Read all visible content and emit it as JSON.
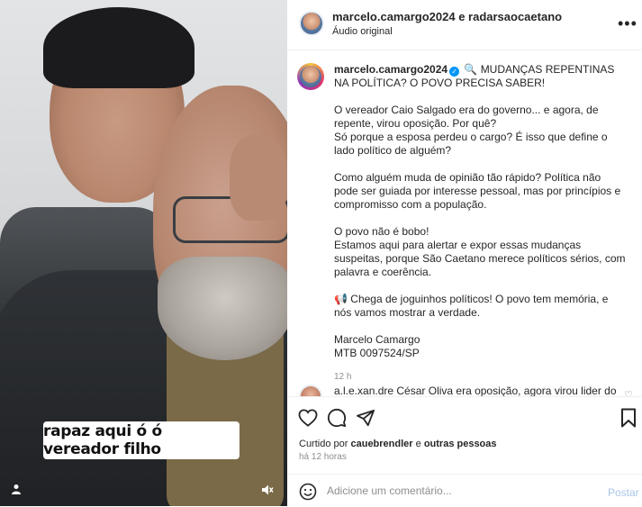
{
  "media": {
    "caption_overlay": "rapaz aqui ó ó vereador filho",
    "user_icon": "user-icon",
    "mute_icon": "speaker-muted-icon"
  },
  "header": {
    "username": "marcelo.camargo2024 e radarsaocaetano",
    "audio": "Áudio original",
    "more_icon": "more-horizontal-icon"
  },
  "caption": {
    "username": "marcelo.camargo2024",
    "verified": true,
    "first_line": " 🔍 MUDANÇAS REPENTINAS NA POLÍTICA? O POVO PRECISA SABER!",
    "paragraphs": [
      "O vereador Caio Salgado era do governo... e agora, de repente, virou oposição. Por quê?\nSó porque a esposa perdeu o cargo? É isso que define o lado político de alguém?",
      "Como alguém muda de opinião tão rápido? Política não pode ser guiada por interesse pessoal, mas por princípios e compromisso com a população.",
      "O povo não é bobo!\nEstamos aqui para alertar e expor essas mudanças suspeitas, porque São Caetano merece políticos sérios, com palavra e coerência.",
      "📢 Chega de joguinhos políticos! O povo tem memória, e nós vamos mostrar a verdade.",
      "Marcelo Camargo\nMTB 0097524/SP"
    ],
    "time": "12 h"
  },
  "reply": {
    "username": "a.l.e.xan.dre",
    "text": "César Oliva era oposição, agora virou lider do"
  },
  "actions": {
    "liked_by_prefix": "Curtido por ",
    "liked_by_user": "cauebrendler",
    "liked_by_suffix": " e ",
    "liked_by_others": "outras pessoas",
    "ago": "há 12 horas"
  },
  "comment_box": {
    "placeholder": "Adicione um comentário...",
    "post_label": "Postar"
  }
}
